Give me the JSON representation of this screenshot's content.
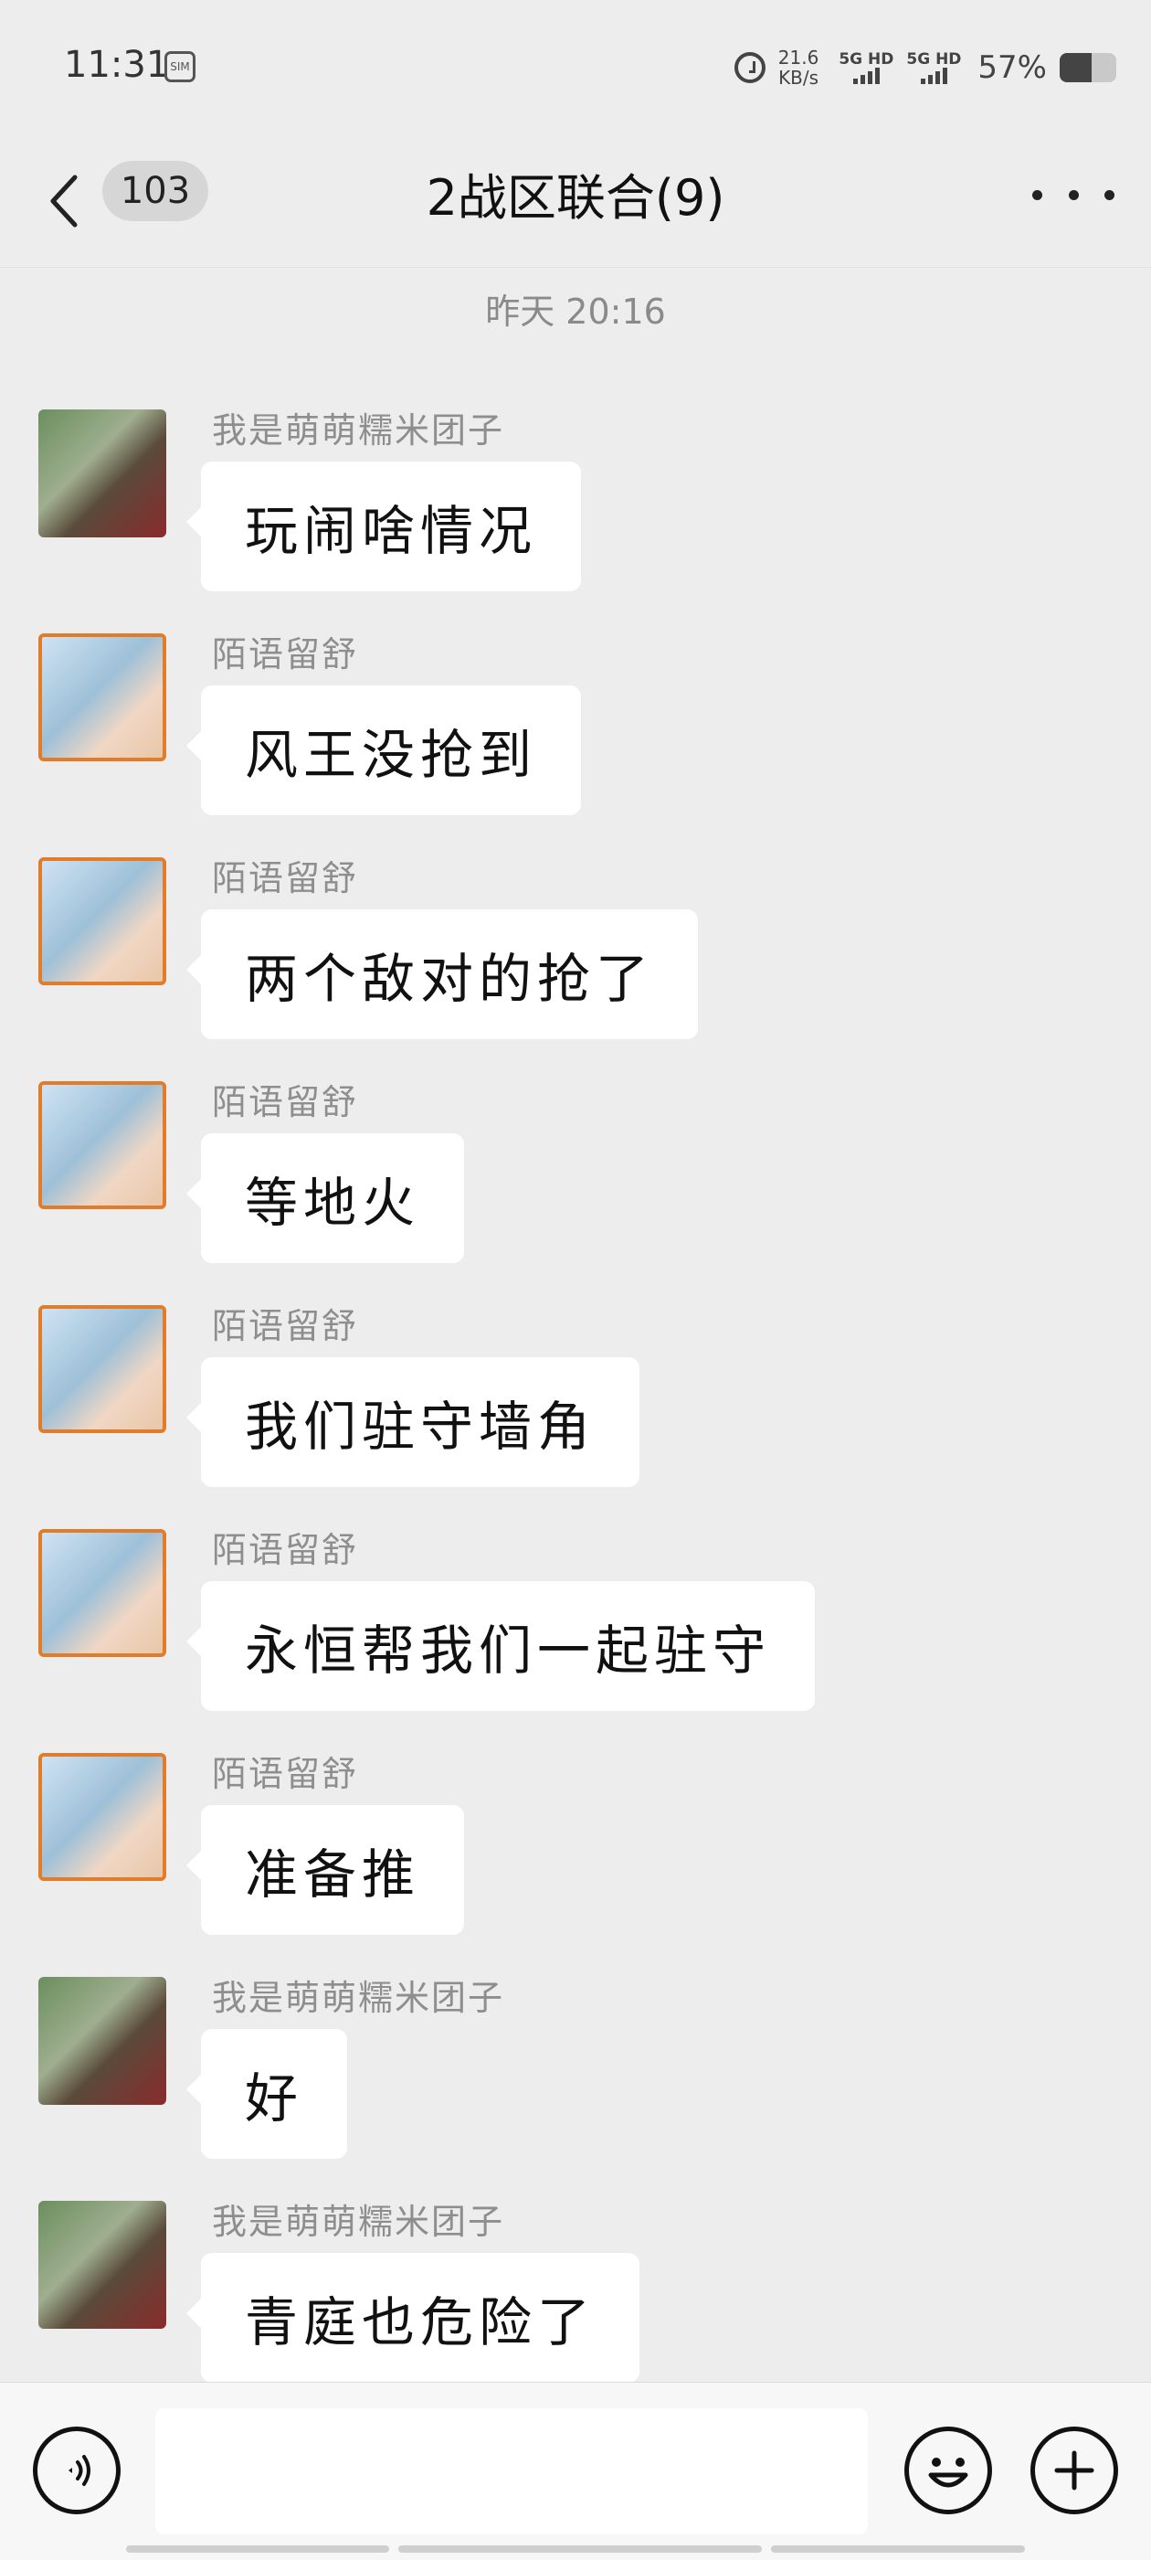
{
  "status_bar": {
    "time": "11:31",
    "sim_icon": "sim-card-icon",
    "net_speed_value": "21.6",
    "net_speed_unit": "KB/s",
    "sig1_label": "5G HD",
    "sig2_label": "5G HD",
    "battery_pct": "57%",
    "battery_level": 0.57
  },
  "header": {
    "back_icon": "chevron-left-icon",
    "unread_count": "103",
    "title": "2战区联合(9)",
    "more_icon": "more-dots-icon"
  },
  "chat": {
    "timestamp": "昨天 20:16",
    "messages": [
      {
        "sender": "我是萌萌糯米团子",
        "text": "玩闹啥情况",
        "avatar": "statue"
      },
      {
        "sender": "陌语留舒",
        "text": "风王没抢到",
        "avatar": "couple"
      },
      {
        "sender": "陌语留舒",
        "text": "两个敌对的抢了",
        "avatar": "couple"
      },
      {
        "sender": "陌语留舒",
        "text": "等地火",
        "avatar": "couple"
      },
      {
        "sender": "陌语留舒",
        "text": "我们驻守墙角",
        "avatar": "couple"
      },
      {
        "sender": "陌语留舒",
        "text": "永恒帮我们一起驻守",
        "avatar": "couple"
      },
      {
        "sender": "陌语留舒",
        "text": "准备推",
        "avatar": "couple"
      },
      {
        "sender": "我是萌萌糯米团子",
        "text": "好",
        "avatar": "statue"
      },
      {
        "sender": "我是萌萌糯米团子",
        "text": "青庭也危险了",
        "avatar": "statue"
      }
    ]
  },
  "input_bar": {
    "voice_icon": "voice-icon",
    "input_value": "",
    "emoji_icon": "emoji-icon",
    "plus_icon": "plus-icon"
  }
}
